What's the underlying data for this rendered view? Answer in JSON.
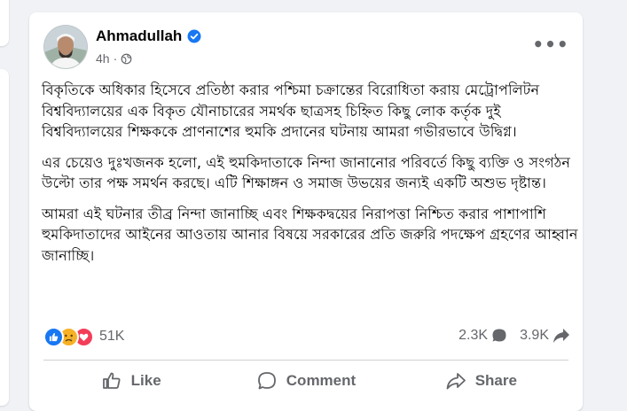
{
  "post": {
    "author": "Ahmadullah",
    "verified": true,
    "time": "4h",
    "privacy_icon": "globe-icon",
    "more_icon": "more-options-icon",
    "paragraphs": [
      "বিকৃতিকে অধিকার হিসেবে প্রতিষ্ঠা করার পশ্চিমা চক্রান্তের বিরোধিতা করায় মেট্রোপলিটন বিশ্ববিদ্যালয়ের এক বিকৃত যৌনাচারের সমর্থক ছাত্রসহ চিহ্নিত কিছু লোক কর্তৃক দুই বিশ্ববিদ্যালয়ের শিক্ষককে প্রাণনাশের হুমকি প্রদানের ঘটনায় আমরা গভীরভাবে উদ্বিগ্ন।",
      "এর চেয়েও দুঃখজনক হলো, এই হুমকিদাতাকে নিন্দা জানানোর পরিবর্তে কিছু ব্যক্তি ও সংগঠন উল্টো তার পক্ষ সমর্থন করছে। এটি শিক্ষাঙ্গন ও সমাজ উভয়ের জন্যই একটি অশুভ দৃষ্টান্ত।",
      "আমরা এই ঘটনার তীব্র নিন্দা জানাচ্ছি এবং শিক্ষকদ্বয়ের নিরাপত্তা নিশ্চিত করার পাশাপাশি হুমকিদাতাদের আইনের আওতায় আনার বিষয়ে সরকারের প্রতি জরুরি পদক্ষেপ গ্রহণের আহ্বান জানাচ্ছি।"
    ]
  },
  "stats": {
    "reactions": [
      "like",
      "sad",
      "love"
    ],
    "reaction_count": "51K",
    "comment_count": "2.3K",
    "share_count": "3.9K"
  },
  "actions": {
    "like_label": "Like",
    "comment_label": "Comment",
    "share_label": "Share"
  },
  "colors": {
    "brand_blue": "#1877f2",
    "secondary_text": "#65676b",
    "background": "#f0f2f5"
  }
}
